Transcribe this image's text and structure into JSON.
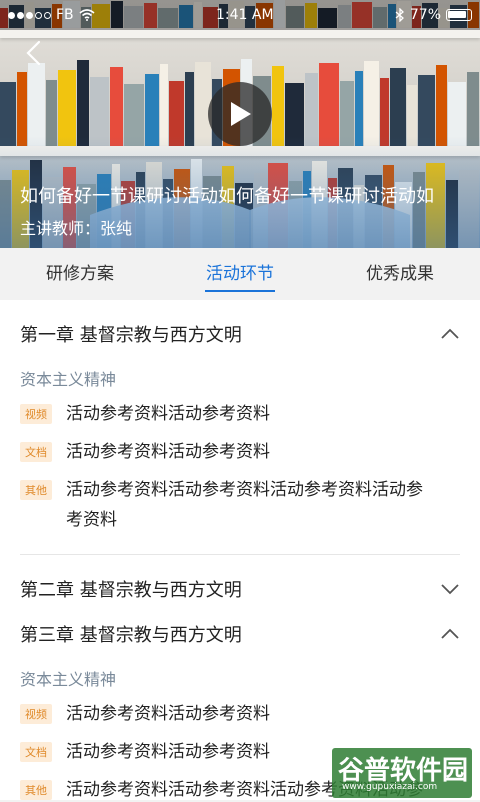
{
  "status_bar": {
    "carrier": "FB",
    "time": "1:41 AM",
    "battery": "77%"
  },
  "header": {
    "course_title": "如何备好一节课研讨活动如何备好一节课研讨活动如",
    "teacher": "主讲教师：张纯"
  },
  "tabs": [
    {
      "label": "研修方案",
      "active": false
    },
    {
      "label": "活动环节",
      "active": true
    },
    {
      "label": "优秀成果",
      "active": false
    }
  ],
  "chapters": [
    {
      "title": "第一章  基督宗教与西方文明",
      "expanded": true,
      "section": "资本主义精神",
      "items": [
        {
          "tag": "视频",
          "text": "活动参考资料活动参考资料"
        },
        {
          "tag": "文档",
          "text": "活动参考资料活动参考资料"
        },
        {
          "tag": "其他",
          "text": "活动参考资料活动参考资料活动参考资料活动参考资料"
        }
      ]
    },
    {
      "title": "第二章  基督宗教与西方文明",
      "expanded": false
    },
    {
      "title": "第三章  基督宗教与西方文明",
      "expanded": true,
      "section": "资本主义精神",
      "items": [
        {
          "tag": "视频",
          "text": "活动参考资料活动参考资料"
        },
        {
          "tag": "文档",
          "text": "活动参考资料活动参考资料"
        },
        {
          "tag": "其他",
          "text": "活动参考资料活动参考资料活动参考资料活动参考资料"
        }
      ]
    }
  ],
  "watermark": {
    "brand": "谷普软件园",
    "url": "www.gupuxiazai.com"
  },
  "colors": {
    "accent": "#1a73d9",
    "tag_bg": "#fdecd8",
    "tag_text": "#e08a2a"
  }
}
